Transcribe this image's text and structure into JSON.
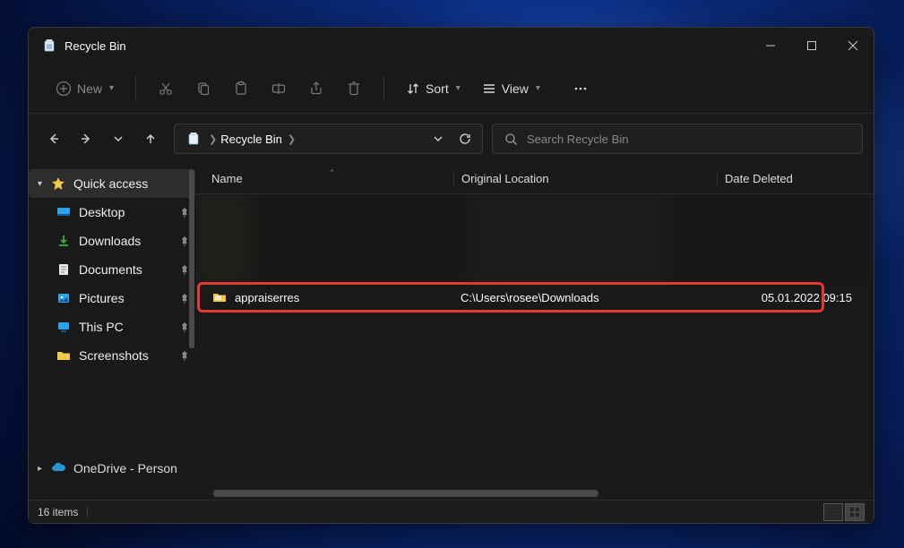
{
  "window": {
    "title": "Recycle Bin"
  },
  "toolbar": {
    "new_label": "New",
    "sort_label": "Sort",
    "view_label": "View"
  },
  "address": {
    "crumb1": "Recycle Bin"
  },
  "search": {
    "placeholder": "Search Recycle Bin"
  },
  "sidebar": {
    "quick_access": "Quick access",
    "items": [
      {
        "label": "Desktop"
      },
      {
        "label": "Downloads"
      },
      {
        "label": "Documents"
      },
      {
        "label": "Pictures"
      },
      {
        "label": "This PC"
      },
      {
        "label": "Screenshots"
      }
    ],
    "onedrive": "OneDrive - Person"
  },
  "columns": {
    "name": "Name",
    "original_location": "Original Location",
    "date_deleted": "Date Deleted"
  },
  "rows": [
    {
      "name": "appraiserres",
      "original_location": "C:\\Users\\rosee\\Downloads",
      "date_deleted": "05.01.2022 09:15"
    }
  ],
  "statusbar": {
    "item_count": "16 items"
  }
}
